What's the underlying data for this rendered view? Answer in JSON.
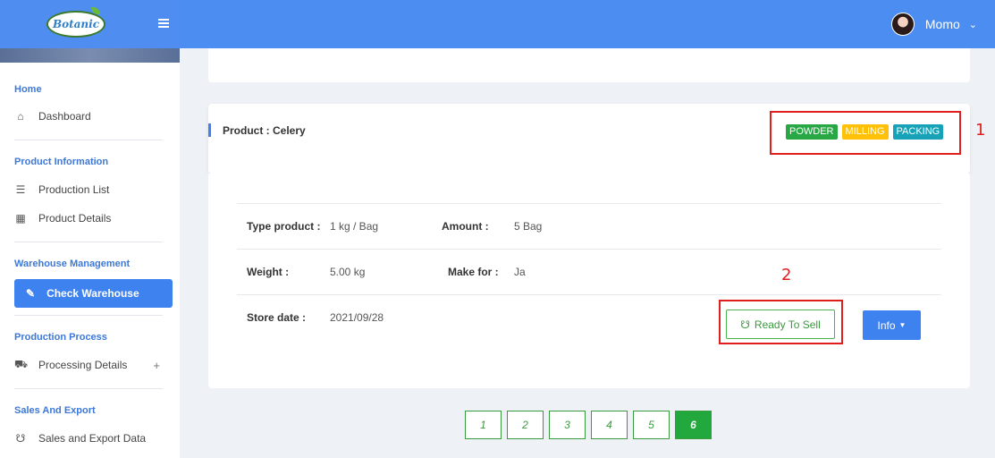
{
  "header": {
    "logo_text": "Botanic",
    "user_name": "Momo",
    "icons": {
      "menu": "hamburger-icon",
      "caret": "chevron-down-icon"
    }
  },
  "sidebar": {
    "sections": [
      {
        "title": "Home",
        "items": [
          {
            "label": "Dashboard",
            "icon": "home-icon"
          }
        ]
      },
      {
        "title": "Product Information",
        "items": [
          {
            "label": "Production List",
            "icon": "list-icon"
          },
          {
            "label": "Product Details",
            "icon": "grid-icon"
          }
        ]
      },
      {
        "title": "Warehouse Management",
        "items": [
          {
            "label": "Check Warehouse",
            "icon": "edit-icon",
            "active": true
          }
        ]
      },
      {
        "title": "Production Process",
        "items": [
          {
            "label": "Processing Details",
            "icon": "truck-icon",
            "expand": "+"
          }
        ]
      },
      {
        "title": "Sales And Export",
        "items": [
          {
            "label": "Sales and Export Data",
            "icon": "cart-icon"
          }
        ]
      }
    ]
  },
  "product": {
    "title": "Product : Celery",
    "badges": [
      {
        "label": "POWDER",
        "color": "#28a745"
      },
      {
        "label": "MILLING",
        "color": "#ffc107"
      },
      {
        "label": "PACKING",
        "color": "#17a2b8"
      }
    ],
    "fields": {
      "type_label": "Type product :",
      "type_value": "1 kg / Bag",
      "amount_label": "Amount :",
      "amount_value": "5 Bag",
      "weight_label": "Weight :",
      "weight_value": "5.00 kg",
      "makefor_label": "Make for :",
      "makefor_value": "Ja",
      "storedate_label": "Store date :",
      "storedate_value": "2021/09/28"
    },
    "actions": {
      "sell_label": "Ready To Sell",
      "info_label": "Info"
    }
  },
  "annotations": {
    "one": "1",
    "two": "2"
  },
  "pagination": {
    "pages": [
      "1",
      "2",
      "3",
      "4",
      "5",
      "6"
    ],
    "active": "6"
  },
  "colors": {
    "accent": "#3e82ef",
    "success": "#23a83d",
    "annotation": "#e01e1e"
  }
}
